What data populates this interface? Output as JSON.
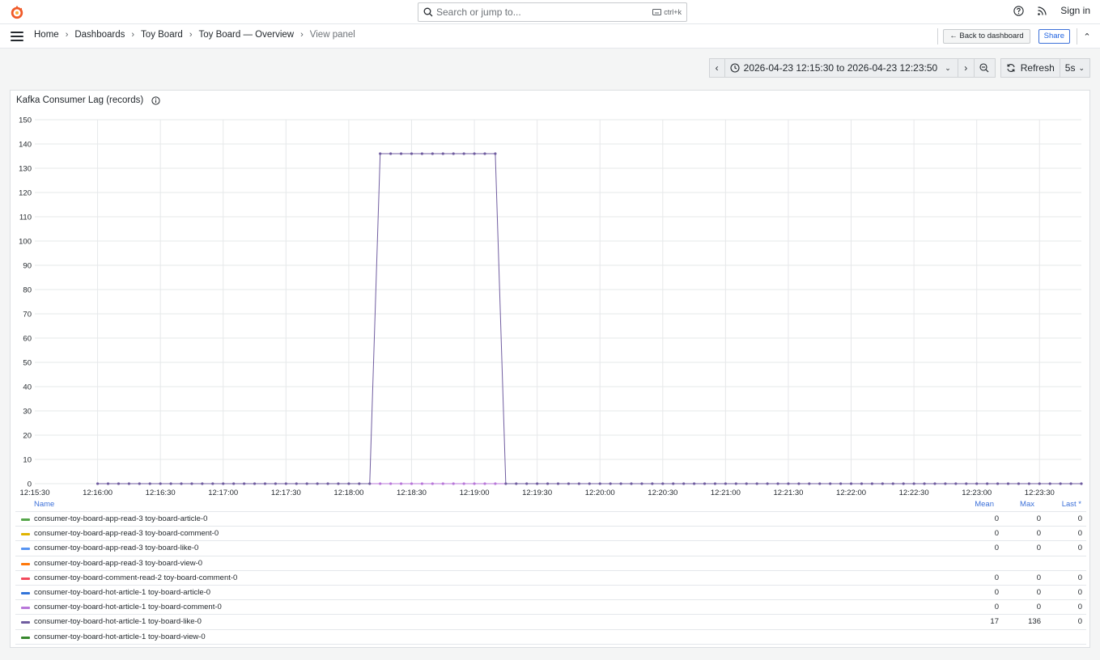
{
  "topbar": {
    "search_placeholder": "Search or jump to...",
    "search_shortcut": "ctrl+k",
    "signin_label": "Sign in"
  },
  "breadcrumb": {
    "items": [
      "Home",
      "Dashboards",
      "Toy Board",
      "Toy Board — Overview"
    ],
    "current": "View panel"
  },
  "actions": {
    "back_label": "Back to dashboard",
    "share_label": "Share"
  },
  "timepicker": {
    "range": "2026-04-23 12:15:30 to 2026-04-23 12:23:50",
    "refresh_label": "Refresh",
    "interval": "5s"
  },
  "panel": {
    "title": "Kafka Consumer Lag (records)"
  },
  "chart_data": {
    "type": "line",
    "title": "Kafka Consumer Lag (records)",
    "ylim": [
      0,
      150
    ],
    "yticks": [
      0,
      10,
      20,
      30,
      40,
      50,
      60,
      70,
      80,
      90,
      100,
      110,
      120,
      130,
      140,
      150
    ],
    "xlim": [
      "12:15:30",
      "12:23:50"
    ],
    "xticks": [
      "12:15:30",
      "12:16:00",
      "12:16:30",
      "12:17:00",
      "12:17:30",
      "12:18:00",
      "12:18:30",
      "12:19:00",
      "12:19:30",
      "12:20:00",
      "12:20:30",
      "12:21:00",
      "12:21:30",
      "12:22:00",
      "12:22:30",
      "12:23:00",
      "12:23:30"
    ],
    "sample_interval": "5s",
    "first_sample": "12:16:00",
    "grid": true,
    "legend_placement": "bottom",
    "series": [
      {
        "name": "consumer-toy-board-app-read-3 toy-board-article-0",
        "color": "#56a64b",
        "mean": "0",
        "max": "0",
        "last": "0"
      },
      {
        "name": "consumer-toy-board-app-read-3 toy-board-comment-0",
        "color": "#e0b400",
        "mean": "0",
        "max": "0",
        "last": "0"
      },
      {
        "name": "consumer-toy-board-app-read-3 toy-board-like-0",
        "color": "#5794f2",
        "mean": "0",
        "max": "0",
        "last": "0"
      },
      {
        "name": "consumer-toy-board-app-read-3 toy-board-view-0",
        "color": "#ff780a",
        "mean": "",
        "max": "",
        "last": ""
      },
      {
        "name": "consumer-toy-board-comment-read-2 toy-board-comment-0",
        "color": "#f2495c",
        "mean": "0",
        "max": "0",
        "last": "0"
      },
      {
        "name": "consumer-toy-board-hot-article-1 toy-board-article-0",
        "color": "#3274d9",
        "mean": "0",
        "max": "0",
        "last": "0"
      },
      {
        "name": "consumer-toy-board-hot-article-1 toy-board-comment-0",
        "color": "#b877d9",
        "mean": "0",
        "max": "0",
        "last": "0"
      },
      {
        "name": "consumer-toy-board-hot-article-1 toy-board-like-0",
        "color": "#705da0",
        "mean": "17",
        "max": "136",
        "last": "0",
        "x": [
          "12:18:10",
          "12:18:15",
          "12:18:20",
          "12:18:25",
          "12:18:30",
          "12:18:35",
          "12:18:40",
          "12:18:45",
          "12:18:50",
          "12:18:55",
          "12:19:00",
          "12:19:05",
          "12:19:10",
          "12:19:15",
          "12:19:20"
        ],
        "y": [
          0,
          136,
          136,
          136,
          136,
          136,
          136,
          136,
          136,
          136,
          136,
          136,
          136,
          0,
          0
        ],
        "baseline": 0
      },
      {
        "name": "consumer-toy-board-hot-article-1 toy-board-view-0",
        "color": "#37872d",
        "mean": "",
        "max": "",
        "last": ""
      }
    ]
  },
  "legend": {
    "col_name": "Name",
    "col_mean": "Mean",
    "col_max": "Max",
    "col_last": "Last *"
  },
  "colors": {
    "accent": "#3d71d9",
    "series_line": "#705da0",
    "series_points_zero": "#b877d9"
  }
}
